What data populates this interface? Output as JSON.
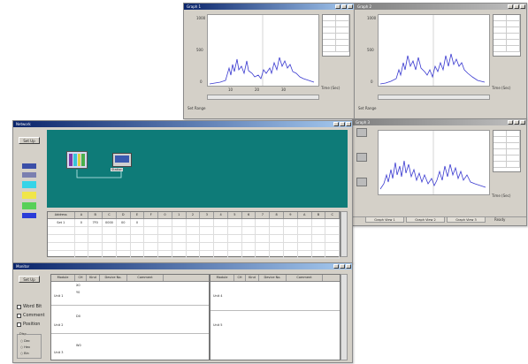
{
  "graph_windows": [
    {
      "title": "Graph 1",
      "tail": "Time (Sec)"
    },
    {
      "title": "Graph 2",
      "tail": "Time (Sec)"
    },
    {
      "title": "Graph 3",
      "tail": "Time (Sec)"
    }
  ],
  "graph_status": {
    "tabs": [
      "Graph View 1",
      "Graph View 2",
      "Graph View 3"
    ],
    "right_text": "Ready"
  },
  "network_window": {
    "title": "Network",
    "setup_label": "Set Up",
    "node_label": "Station",
    "table_headers": [
      "Address",
      "A",
      "B",
      "C",
      "D",
      "E",
      "F",
      "0",
      "1",
      "2",
      "3",
      "4",
      "5",
      "6",
      "7",
      "8",
      "9",
      "A",
      "B",
      "C"
    ],
    "table_rows": [
      [
        "Set 1",
        "0",
        "7F0",
        "0000",
        "00",
        "0"
      ]
    ]
  },
  "monitor_window": {
    "title": "Monitor",
    "setup_label": "Set Up",
    "options": [
      "Word Bit",
      "Comment",
      "Position"
    ],
    "radio_label": "Disp",
    "radio_options": [
      "Dec",
      "Hex",
      "Bin"
    ],
    "headers": [
      "Module",
      "CH",
      "Kind",
      "Device No.",
      "Comment"
    ],
    "left_groups": [
      "Unit 1",
      "Unit 2",
      "Unit 3"
    ],
    "right_groups": [
      "Unit 4",
      "Unit 5"
    ],
    "cells": [
      "X0",
      "Y0",
      "D0",
      "W0"
    ]
  },
  "colors": {
    "teal": "#0e7b78",
    "plot_line": "#3a3ad0",
    "title_active": "#0a246a"
  }
}
